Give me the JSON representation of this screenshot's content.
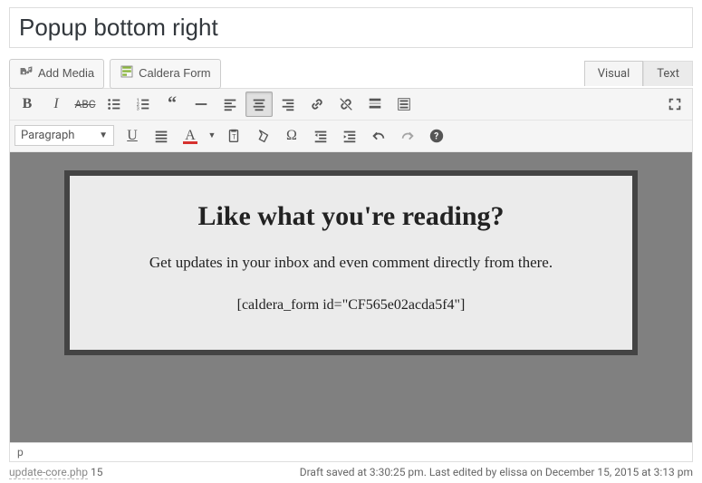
{
  "title": "Popup bottom right",
  "buttons": {
    "add_media": "Add Media",
    "caldera_form": "Caldera Form"
  },
  "tabs": {
    "visual": "Visual",
    "text": "Text"
  },
  "format_select": "Paragraph",
  "content": {
    "heading": "Like what you're reading?",
    "paragraph": "Get updates in your inbox and even comment directly from there.",
    "shortcode": "[caldera_form id=\"CF565e02acda5f4\"]"
  },
  "path": "p",
  "footer": {
    "file_hint": "update-core.php",
    "line_hint": "15",
    "status": "Draft saved at 3:30:25 pm. Last edited by elissa on December 15, 2015 at 3:13 pm"
  }
}
